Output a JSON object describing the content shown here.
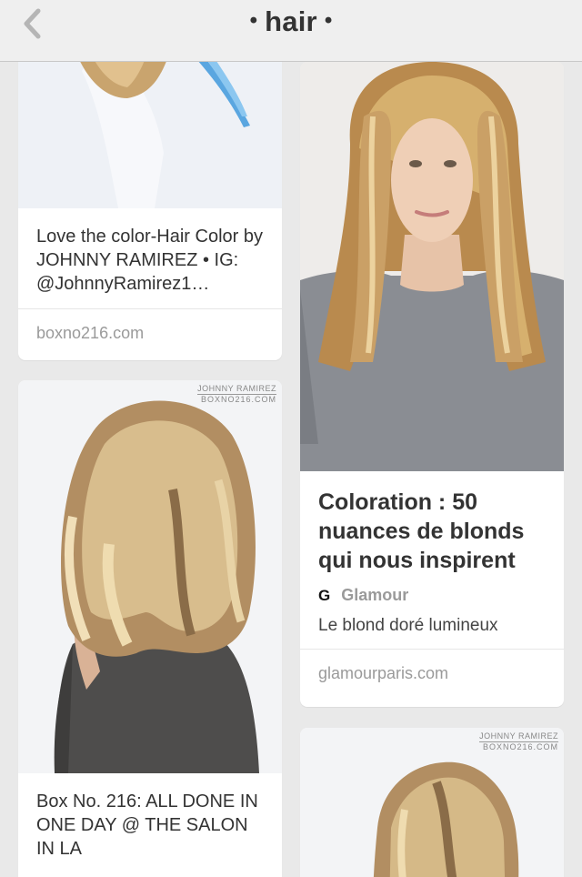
{
  "navbar": {
    "title": "hair",
    "dot": "•",
    "back_icon": "chevron-left-icon"
  },
  "pins": [
    {
      "description": "Love the color-Hair Color by JOHNNY RAMIREZ • IG: @JohnnyRamirez1…",
      "source": "boxno216.com"
    },
    {
      "title": "Coloration : 50 nuances de blonds qui nous inspirent",
      "attribution_icon": "G",
      "attribution": "Glamour",
      "subtitle": "Le blond doré lumineux",
      "source": "glamourparis.com"
    },
    {
      "watermark_line1": "JOHNNY RAMIREZ",
      "watermark_line2": "BOXNO216.COM",
      "description": "Box No. 216: ALL DONE IN ONE DAY @ THE SALON IN LA"
    },
    {
      "watermark_line1": "JOHNNY RAMIREZ",
      "watermark_line2": "BOXNO216.COM"
    }
  ],
  "colors": {
    "nav_background": "#efefef",
    "feed_background": "#e9e9e9",
    "text_primary": "#333333",
    "text_muted": "#9a9a9a"
  }
}
